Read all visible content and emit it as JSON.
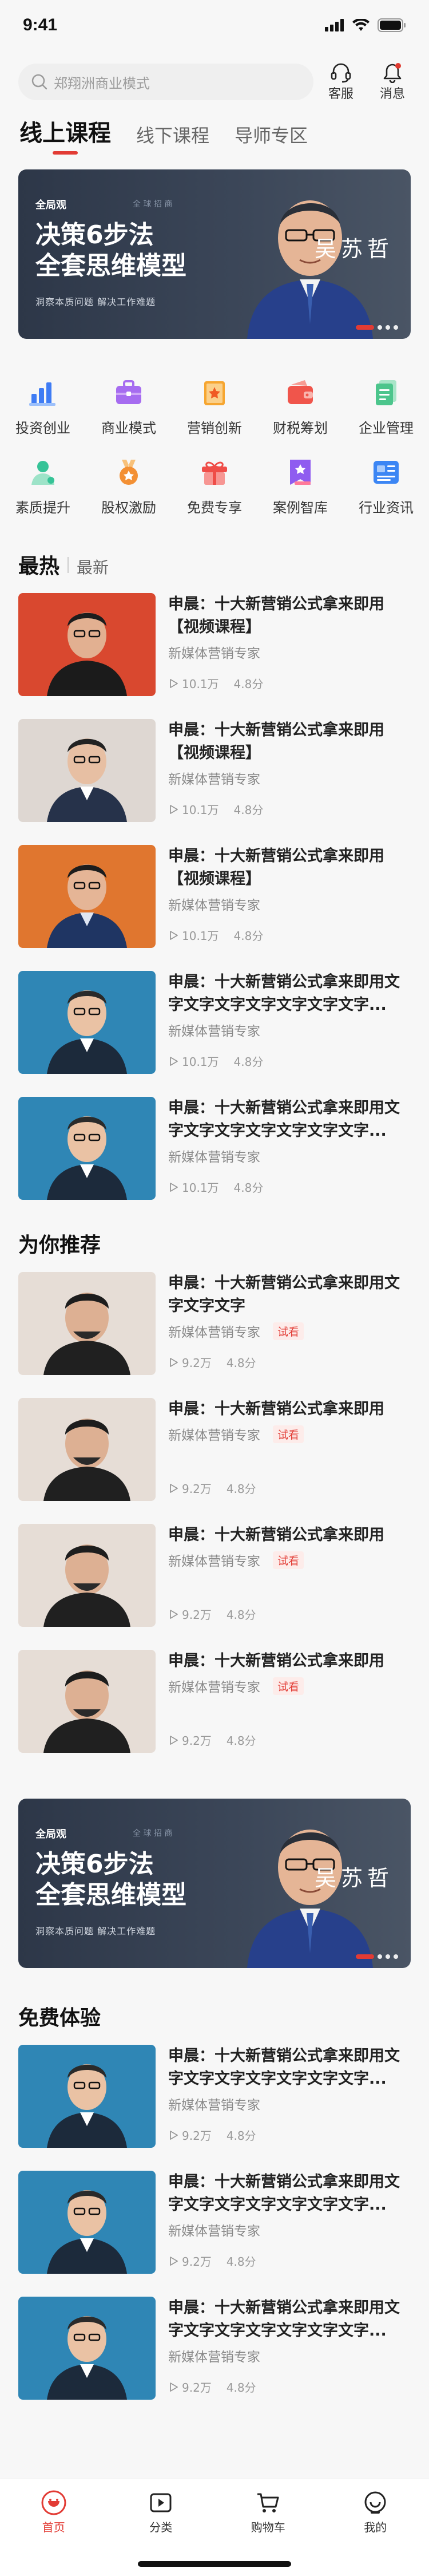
{
  "status_bar": {
    "time": "9:41"
  },
  "header": {
    "search_placeholder": "郑翔洲商业模式",
    "service_label": "客服",
    "message_label": "消息"
  },
  "tabs": [
    {
      "label": "线上课程",
      "active": true
    },
    {
      "label": "线下课程",
      "active": false
    },
    {
      "label": "导师专区",
      "active": false
    }
  ],
  "banner": {
    "tagline": "全局观",
    "sub_tag": "全 球 招 商",
    "title_line1": "决策6步法",
    "title_line2": "全套思维模型",
    "desc": "洞察本质问题    解决工作难题",
    "person_name": "吴苏哲"
  },
  "categories": [
    {
      "label": "投资创业",
      "icon": "bar-chart-icon",
      "color": "#3f7cf4"
    },
    {
      "label": "商业模式",
      "icon": "briefcase-icon",
      "color": "#a66cf0"
    },
    {
      "label": "营销创新",
      "icon": "star-book-icon",
      "color": "#f6a631"
    },
    {
      "label": "财税筹划",
      "icon": "wallet-icon",
      "color": "#f0554b"
    },
    {
      "label": "企业管理",
      "icon": "document-icon",
      "color": "#4cc58c"
    },
    {
      "label": "素质提升",
      "icon": "person-icon",
      "color": "#36c397"
    },
    {
      "label": "股权激励",
      "icon": "medal-icon",
      "color": "#f39034"
    },
    {
      "label": "免费专享",
      "icon": "gift-icon",
      "color": "#ef4d48"
    },
    {
      "label": "案例智库",
      "icon": "bookmark-icon",
      "color": "#8f5cf0"
    },
    {
      "label": "行业资讯",
      "icon": "news-icon",
      "color": "#3c86f4"
    }
  ],
  "hot_section": {
    "title": "最热",
    "subtitle": "最新"
  },
  "hot_items": [
    {
      "title": "申晨：十大新营销公式拿来即用【视频课程】",
      "author": "新媒体营销专家",
      "plays": "10.1万",
      "score": "4.8分",
      "bg": "#d9482f",
      "shirt": "#1b1b1b"
    },
    {
      "title": "申晨：十大新营销公式拿来即用【视频课程】",
      "author": "新媒体营销专家",
      "plays": "10.1万",
      "score": "4.8分",
      "bg": "#ded7d2",
      "shirt": "#26324a"
    },
    {
      "title": "申晨：十大新营销公式拿来即用【视频课程】",
      "author": "新媒体营销专家",
      "plays": "10.1万",
      "score": "4.8分",
      "bg": "#e0762f",
      "shirt": "#1f3563"
    },
    {
      "title": "申晨：十大新营销公式拿来即用文字文字文字文字文字文字文字...",
      "author": "新媒体营销专家",
      "plays": "10.1万",
      "score": "4.8分",
      "bg": "#2f86b5",
      "shirt": "#1c2a3b"
    },
    {
      "title": "申晨：十大新营销公式拿来即用文字文字文字文字文字文字文字...",
      "author": "新媒体营销专家",
      "plays": "10.1万",
      "score": "4.8分",
      "bg": "#2f86b5",
      "shirt": "#1c2a3b"
    }
  ],
  "recommend_section": {
    "title": "为你推荐"
  },
  "recommend_items": [
    {
      "title": "申晨：十大新营销公式拿来即用文字文字文字",
      "author": "新媒体营销专家",
      "tag": "试看",
      "plays": "9.2万",
      "score": "4.8分"
    },
    {
      "title": "申晨：十大新营销公式拿来即用",
      "author": "新媒体营销专家",
      "tag": "试看",
      "plays": "9.2万",
      "score": "4.8分"
    },
    {
      "title": "申晨：十大新营销公式拿来即用",
      "author": "新媒体营销专家",
      "tag": "试看",
      "plays": "9.2万",
      "score": "4.8分"
    },
    {
      "title": "申晨：十大新营销公式拿来即用",
      "author": "新媒体营销专家",
      "tag": "试看",
      "plays": "9.2万",
      "score": "4.8分"
    }
  ],
  "free_section": {
    "title": "免费体验"
  },
  "free_items": [
    {
      "title": "申晨：十大新营销公式拿来即用文字文字文字文字文字文字文字...",
      "author": "新媒体营销专家",
      "plays": "9.2万",
      "score": "4.8分"
    },
    {
      "title": "申晨：十大新营销公式拿来即用文字文字文字文字文字文字文字...",
      "author": "新媒体营销专家",
      "plays": "9.2万",
      "score": "4.8分"
    },
    {
      "title": "申晨：十大新营销公式拿来即用文字文字文字文字文字文字文字...",
      "author": "新媒体营销专家",
      "plays": "9.2万",
      "score": "4.8分"
    }
  ],
  "tabbar": [
    {
      "label": "首页",
      "icon": "home-icon",
      "active": true
    },
    {
      "label": "分类",
      "icon": "category-icon",
      "active": false
    },
    {
      "label": "购物车",
      "icon": "cart-icon",
      "active": false
    },
    {
      "label": "我的",
      "icon": "profile-icon",
      "active": false
    }
  ],
  "colors": {
    "accent": "#e23b34",
    "banner_bg": "#2d3748"
  }
}
